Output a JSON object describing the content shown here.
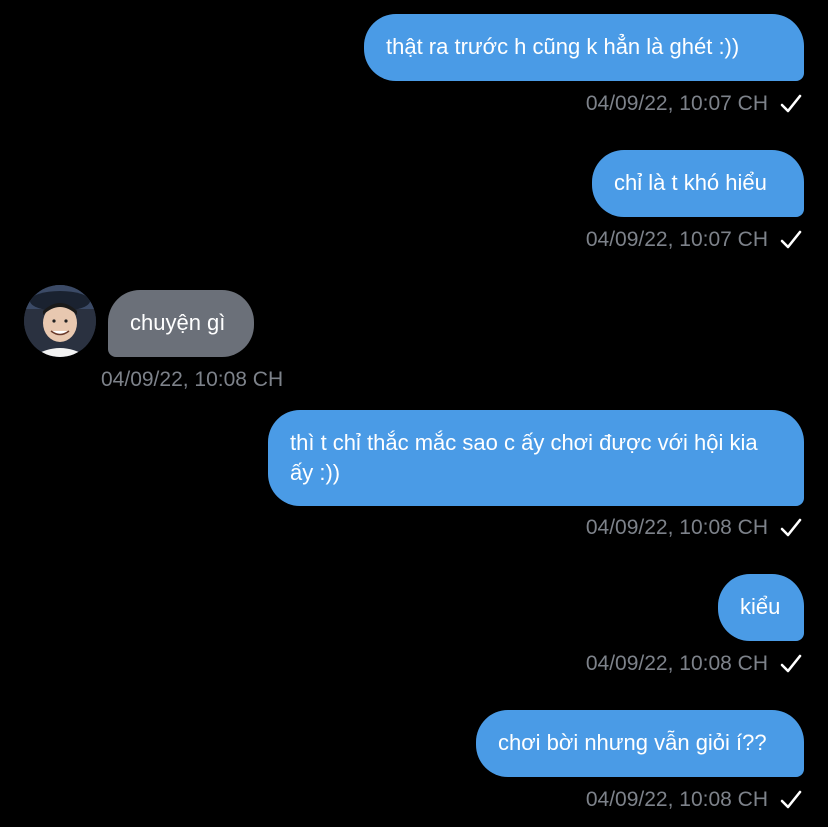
{
  "messages": [
    {
      "text": "thật ra trước h cũng k hẳn là ghét :))",
      "timestamp": "04/09/22, 10:07 CH",
      "direction": "out"
    },
    {
      "text": "chỉ là t khó hiểu",
      "timestamp": "04/09/22, 10:07 CH",
      "direction": "out"
    },
    {
      "text": "chuyện gì",
      "timestamp": "04/09/22, 10:08 CH",
      "direction": "in"
    },
    {
      "text": "thì t chỉ thắc mắc sao c ấy chơi được với hội kia ấy :))",
      "timestamp": "04/09/22, 10:08 CH",
      "direction": "out"
    },
    {
      "text": "kiểu",
      "timestamp": "04/09/22, 10:08 CH",
      "direction": "out"
    },
    {
      "text": "chơi bời nhưng vẫn giỏi í??",
      "timestamp": "04/09/22, 10:08 CH",
      "direction": "out"
    }
  ],
  "icons": {
    "read_receipt": "checkmark-icon",
    "avatar": "contact-avatar"
  },
  "colors": {
    "background": "#000000",
    "outgoing_bubble": "#4a9be6",
    "incoming_bubble": "#6b7079",
    "timestamp": "#7d828a",
    "check": "#ffffff"
  }
}
